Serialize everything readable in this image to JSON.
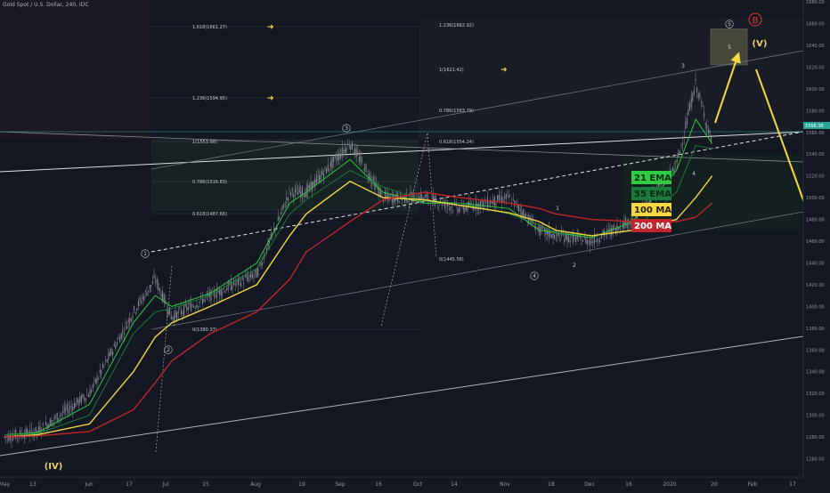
{
  "header": {
    "symbol_title": "Gold Spot / U.S. Dollar, 240, IDC"
  },
  "colors": {
    "background": "#131722",
    "candle": "#8c8f9a",
    "ema21": "#2ecc40",
    "ema55": "#1a7a3a",
    "ma100": "#f5d742",
    "ma200": "#c0262c",
    "channel": "#9598a1",
    "fib": "#c8c8c8",
    "arrow": "#f5d742",
    "price_tag": "#26a69a",
    "wave_b": "#e53935"
  },
  "chart_data": {
    "type": "line",
    "title": "Gold Spot / U.S. Dollar, 240, IDC",
    "xlabel": "",
    "ylabel": "",
    "ylim": [
      1250,
      1690
    ],
    "grid": false,
    "x_ticks": [
      "May",
      "13",
      "Jun",
      "17",
      "Jul",
      "15",
      "Aug",
      "19",
      "Sep",
      "16",
      "Oct",
      "14",
      "Nov",
      "18",
      "Dec",
      "16",
      "2020",
      "20",
      "Feb",
      "17"
    ],
    "y_ticks": [
      1260,
      1280,
      1300,
      1320,
      1340,
      1360,
      1380,
      1400,
      1420,
      1440,
      1460,
      1480,
      1500,
      1520,
      1540,
      1560,
      1580,
      1600,
      1620,
      1640,
      1660,
      1680
    ],
    "current_price": 1566.38,
    "price_series": {
      "name": "",
      "x": [
        "May 1",
        "May 13",
        "Jun 1",
        "Jun 17",
        "Jun 25",
        "Jul 1",
        "Jul 15",
        "Aug 1",
        "Aug 13",
        "Aug 19",
        "Sep 4",
        "Sep 16",
        "Oct 1",
        "Oct 14",
        "Nov 1",
        "Nov 12",
        "Nov 18",
        "Dec 1",
        "Dec 16",
        "Jan 1",
        "Jan 8",
        "Jan 14"
      ],
      "values": [
        1280,
        1285,
        1320,
        1395,
        1425,
        1390,
        1410,
        1430,
        1505,
        1505,
        1550,
        1500,
        1500,
        1490,
        1500,
        1470,
        1465,
        1460,
        1480,
        1530,
        1605,
        1550
      ]
    },
    "series": [
      {
        "name": "21 EMA",
        "values": [
          1282,
          1284,
          1310,
          1385,
          1410,
          1400,
          1412,
          1440,
          1495,
          1505,
          1535,
          1505,
          1495,
          1495,
          1490,
          1470,
          1468,
          1463,
          1478,
          1525,
          1572,
          1550
        ]
      },
      {
        "name": "55 EMA",
        "values": [
          1282,
          1283,
          1300,
          1375,
          1395,
          1398,
          1410,
          1435,
          1485,
          1498,
          1525,
          1510,
          1497,
          1495,
          1485,
          1475,
          1468,
          1465,
          1470,
          1505,
          1548,
          1545
        ]
      },
      {
        "name": "100 MA",
        "values": [
          1280,
          1282,
          1292,
          1340,
          1372,
          1385,
          1400,
          1420,
          1465,
          1485,
          1515,
          1500,
          1498,
          1493,
          1486,
          1478,
          1470,
          1465,
          1470,
          1480,
          1500,
          1520
        ]
      },
      {
        "name": "200 MA",
        "values": [
          1280,
          1281,
          1285,
          1305,
          1330,
          1350,
          1375,
          1395,
          1425,
          1450,
          1478,
          1498,
          1505,
          1500,
          1495,
          1490,
          1485,
          1480,
          1478,
          1478,
          1482,
          1495
        ]
      }
    ],
    "legend": [
      "21 EMA",
      "55 EMA",
      "100 MA",
      "200 MA"
    ],
    "fib_levels_left": [
      "1.618(1661.27)",
      "1.236(1594.95)",
      "1(1553.98)",
      "0.786(1516.83)",
      "0.618(1487.66)",
      "0(1380.37)"
    ],
    "fib_levels_right": [
      "1.236(1662.92)",
      "1(1621.42)",
      "0.786(1583.79)",
      "0.618(1554.24)",
      "0(1445.56)"
    ],
    "wave_labels": {
      "circled": [
        "1",
        "2",
        "3",
        "4",
        "5"
      ],
      "plain": [
        "1",
        "2",
        "3",
        "4",
        "5"
      ],
      "b": "B",
      "roman": [
        "(IV)",
        "(V)"
      ]
    }
  }
}
